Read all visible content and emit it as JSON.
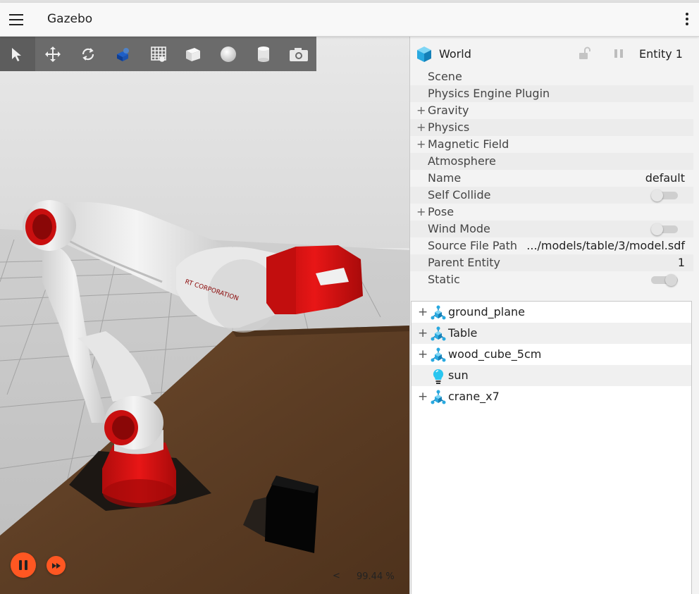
{
  "app": {
    "title": "Gazebo"
  },
  "toolbar": {
    "tools": [
      {
        "name": "select-icon"
      },
      {
        "name": "translate-icon"
      },
      {
        "name": "rotate-icon"
      },
      {
        "name": "transform-control-icon"
      },
      {
        "name": "grid-config-icon"
      },
      {
        "name": "box-shape-icon"
      },
      {
        "name": "sphere-shape-icon"
      },
      {
        "name": "cylinder-shape-icon"
      },
      {
        "name": "screenshot-icon"
      }
    ]
  },
  "viewport": {
    "robot_brand": "RT CORPORATION",
    "rtf_value": "99.44 %",
    "rtf_chevron": "<"
  },
  "component_inspector": {
    "title": "World",
    "entity_label": "Entity 1",
    "properties": [
      {
        "name": "Scene",
        "expandable": false
      },
      {
        "name": "Physics Engine Plugin",
        "expandable": false
      },
      {
        "name": "Gravity",
        "expandable": true
      },
      {
        "name": "Physics",
        "expandable": true
      },
      {
        "name": "Magnetic Field",
        "expandable": true
      },
      {
        "name": "Atmosphere",
        "expandable": false
      },
      {
        "name": "Name",
        "value": "default"
      },
      {
        "name": "Self Collide",
        "toggle": "off"
      },
      {
        "name": "Pose",
        "expandable": true
      },
      {
        "name": "Wind Mode",
        "toggle": "off"
      },
      {
        "name": "Source File Path",
        "value": ".../models/table/3/model.sdf"
      },
      {
        "name": "Parent Entity",
        "value": "1"
      },
      {
        "name": "Static",
        "toggle": "on"
      }
    ],
    "plus_glyph": "+"
  },
  "entity_tree": {
    "items": [
      {
        "name": "ground_plane",
        "expandable": true,
        "icon": "model-icon"
      },
      {
        "name": "Table",
        "expandable": true,
        "icon": "model-icon"
      },
      {
        "name": "wood_cube_5cm",
        "expandable": true,
        "icon": "model-icon"
      },
      {
        "name": "sun",
        "expandable": false,
        "icon": "light-bulb-icon"
      },
      {
        "name": "crane_x7",
        "expandable": true,
        "icon": "model-icon"
      }
    ]
  },
  "colors": {
    "accent": "#ff5722",
    "robot_red": "#d81010",
    "table_wood": "#5a3a22",
    "model_icon": "#29a9e0"
  }
}
